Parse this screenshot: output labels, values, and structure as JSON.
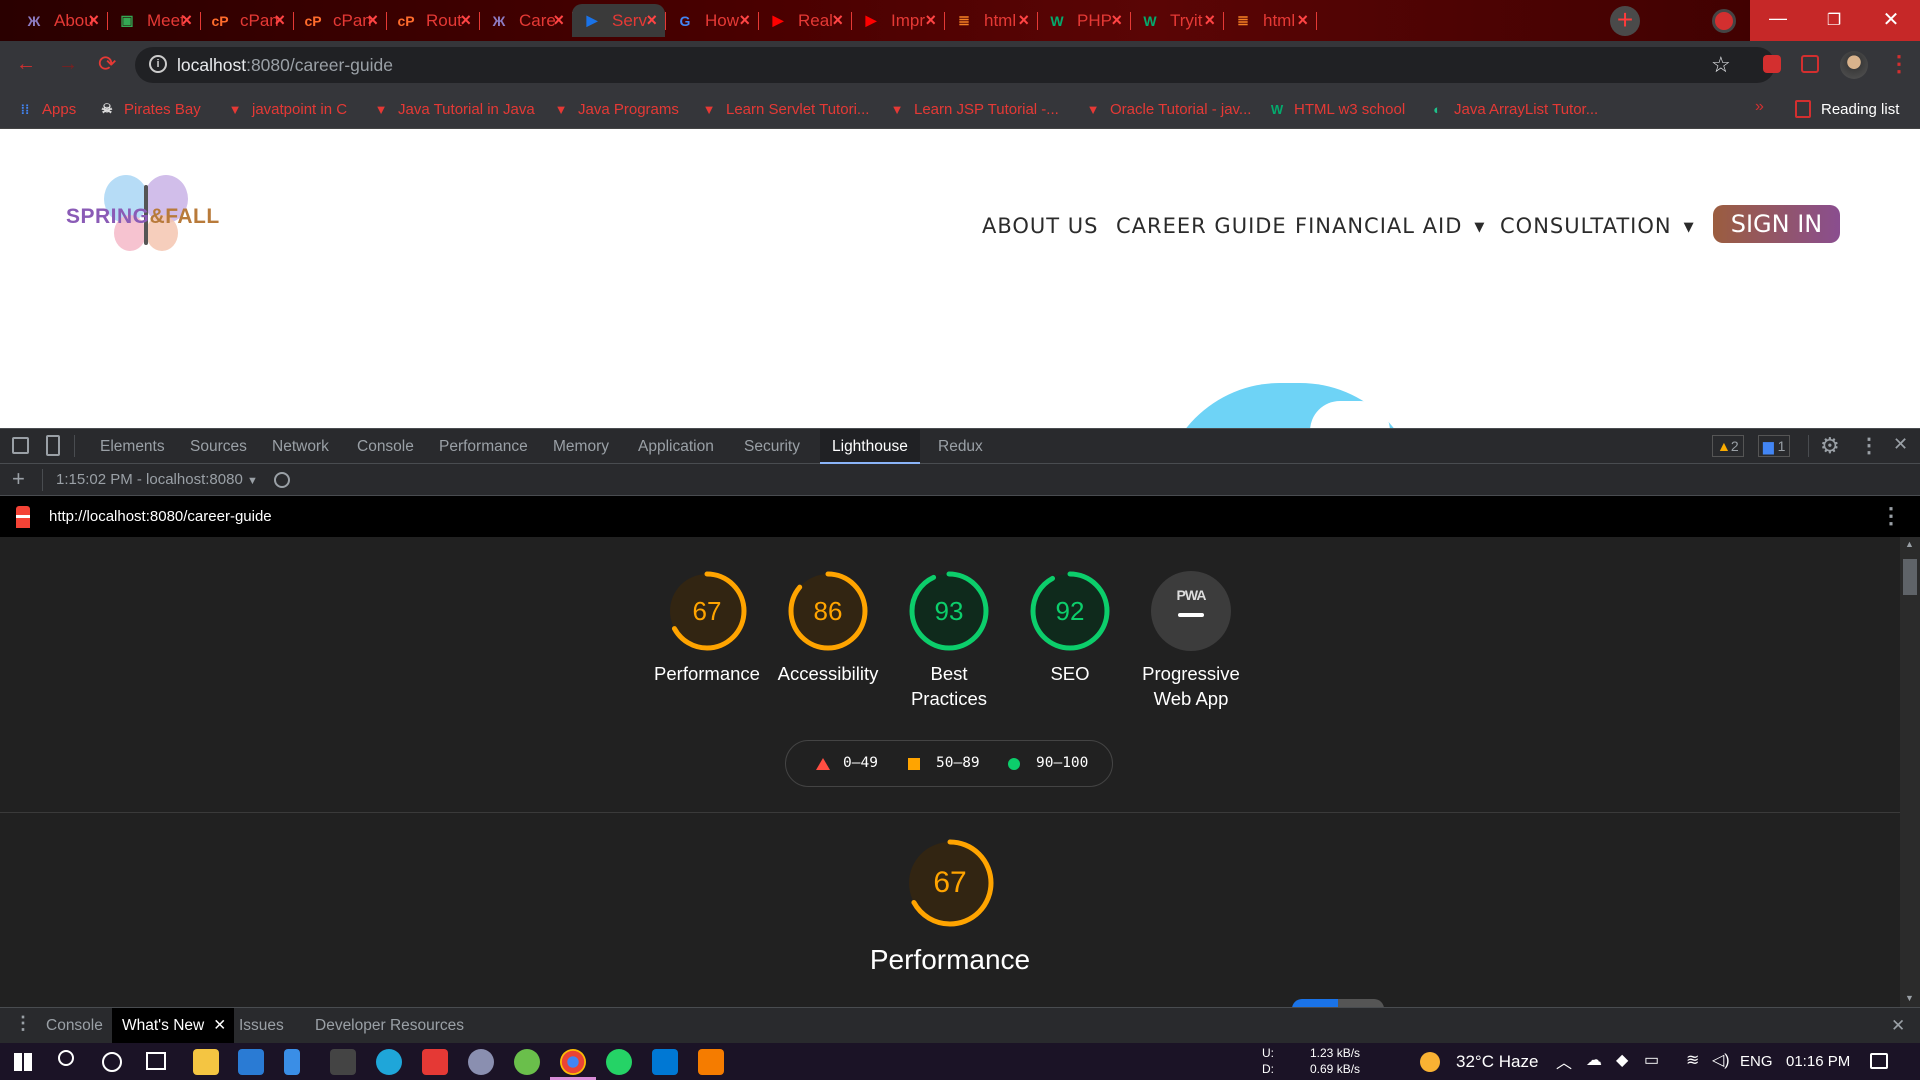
{
  "tabs": [
    {
      "label": "Abou",
      "icon": "butterfly-icon",
      "color": "#8e7cc3"
    },
    {
      "label": "Meet",
      "icon": "meet-icon",
      "color": "#34a853"
    },
    {
      "label": "cPan",
      "icon": "cpanel-icon",
      "color": "#ff6c2c"
    },
    {
      "label": "cPan",
      "icon": "cpanel-icon",
      "color": "#ff6c2c"
    },
    {
      "label": "Rout",
      "icon": "cpanel-icon",
      "color": "#ff6c2c"
    },
    {
      "label": "Care",
      "icon": "butterfly-icon",
      "color": "#8e7cc3"
    },
    {
      "label": "Serv",
      "icon": "servlet-icon",
      "color": "#1a73e8"
    },
    {
      "label": "How",
      "icon": "google-icon",
      "color": "#4285f4"
    },
    {
      "label": "Real",
      "icon": "youtube-icon",
      "color": "#ff0000"
    },
    {
      "label": "Impr",
      "icon": "youtube-icon",
      "color": "#ff0000"
    },
    {
      "label": "html",
      "icon": "stackoverflow-icon",
      "color": "#f48024"
    },
    {
      "label": "PHP",
      "icon": "w3schools-icon",
      "color": "#04aa6d"
    },
    {
      "label": "Tryit",
      "icon": "w3schools-icon",
      "color": "#04aa6d"
    },
    {
      "label": "html",
      "icon": "stackoverflow-icon",
      "color": "#f48024"
    }
  ],
  "address": {
    "host": "localhost",
    "path": ":8080/career-guide"
  },
  "bookmarks": [
    {
      "label": "Apps",
      "icon": "apps-grid-icon"
    },
    {
      "label": "Pirates Bay",
      "icon": "pirate-icon"
    },
    {
      "label": "javatpoint in C",
      "icon": "javatpoint-icon"
    },
    {
      "label": "Java Tutorial in Java",
      "icon": "javatpoint-icon"
    },
    {
      "label": "Java Programs",
      "icon": "javatpoint-icon"
    },
    {
      "label": "Learn Servlet Tutori...",
      "icon": "javatpoint-icon"
    },
    {
      "label": "Learn JSP Tutorial -...",
      "icon": "javatpoint-icon"
    },
    {
      "label": "Oracle Tutorial - jav...",
      "icon": "javatpoint-icon"
    },
    {
      "label": "HTML w3 school",
      "icon": "w3schools-icon"
    },
    {
      "label": "Java ArrayList Tutor...",
      "icon": "codegym-icon"
    }
  ],
  "reading_list": "Reading list",
  "site": {
    "logo": {
      "left": "SPRING",
      "amp": "&",
      "right": "FALL"
    },
    "nav": [
      "ABOUT US",
      "CAREER GUIDE",
      "FINANCIAL AID",
      "CONSULTATION"
    ],
    "signin": "SIGN IN"
  },
  "devtools": {
    "tabs": [
      "Elements",
      "Sources",
      "Network",
      "Console",
      "Performance",
      "Memory",
      "Application",
      "Security",
      "Lighthouse",
      "Redux"
    ],
    "warnings": "2",
    "messages": "1",
    "report_select": "1:15:02 PM - localhost:8080",
    "report_url": "http://localhost:8080/career-guide"
  },
  "lighthouse": {
    "scores": [
      {
        "label": "Performance",
        "value": 67,
        "color": "#ffa400"
      },
      {
        "label": "Accessibility",
        "value": 86,
        "color": "#ffa400"
      },
      {
        "label": "Best\nPractices",
        "value": 93,
        "color": "#0cce6b"
      },
      {
        "label": "SEO",
        "value": 92,
        "color": "#0cce6b"
      }
    ],
    "pwa": {
      "label": "Progressive\nWeb App",
      "badge": "PWA"
    },
    "legend": [
      "0–49",
      "50–89",
      "90–100"
    ],
    "section": {
      "value": 67,
      "title": "Performance"
    }
  },
  "drawer": [
    "Console",
    "What's New",
    "Issues",
    "Developer Resources"
  ],
  "taskbar": {
    "net_u_label": "U:",
    "net_d_label": "D:",
    "net_u": "1.23 kB/s",
    "net_d": "0.69 kB/s",
    "weather": "32°C  Haze",
    "lang": "ENG",
    "time": "01:16 PM"
  }
}
